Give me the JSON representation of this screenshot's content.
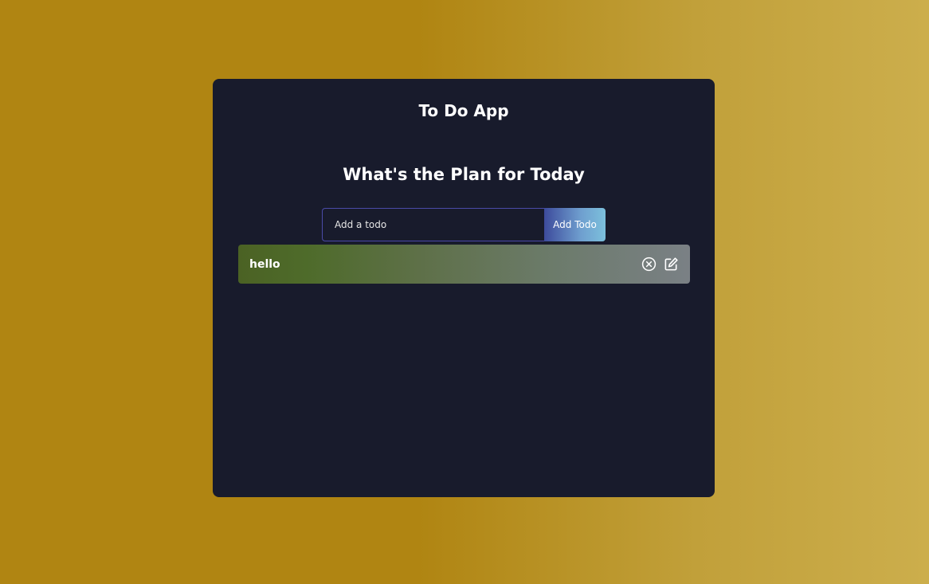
{
  "header": {
    "app_title": "To Do App",
    "plan_heading": "What's the Plan for Today"
  },
  "form": {
    "input_placeholder": "Add a todo",
    "input_value": "",
    "add_button_label": "Add Todo"
  },
  "todos": [
    {
      "text": "hello"
    }
  ],
  "icons": {
    "delete": "close-circle-icon",
    "edit": "edit-icon"
  },
  "colors": {
    "card_bg": "#181b2c",
    "background_start": "#b08512",
    "background_end": "#ccae4c"
  }
}
